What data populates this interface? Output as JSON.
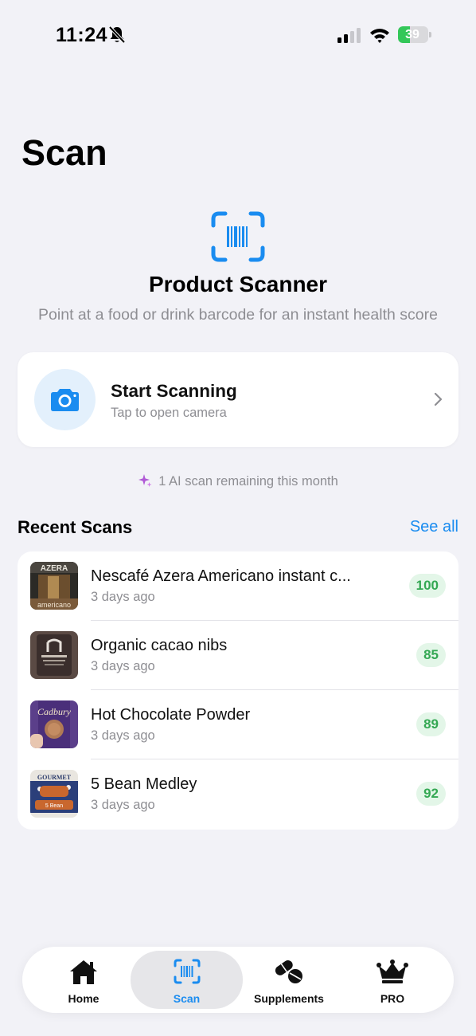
{
  "status_bar": {
    "time": "11:24",
    "battery": "39",
    "battery_level": 0.39
  },
  "page": {
    "title": "Scan"
  },
  "hero": {
    "title": "Product Scanner",
    "subtitle": "Point at a food or drink barcode for an instant health score",
    "icon": "barcode-scan-icon"
  },
  "scan_card": {
    "title": "Start Scanning",
    "subtitle": "Tap to open camera",
    "icon": "camera-icon"
  },
  "ai_note": "1 AI scan remaining this month",
  "recent": {
    "title": "Recent Scans",
    "see_all": "See all",
    "items": [
      {
        "name": "Nescafé Azera Americano instant c...",
        "time": "3 days ago",
        "score": "100"
      },
      {
        "name": "Organic cacao nibs",
        "time": "3 days ago",
        "score": "85"
      },
      {
        "name": "Hot Chocolate Powder",
        "time": "3 days ago",
        "score": "89"
      },
      {
        "name": "5 Bean Medley",
        "time": "3 days ago",
        "score": "92"
      }
    ]
  },
  "tab_bar": {
    "active": "Scan",
    "tabs": [
      {
        "label": "Home",
        "icon": "house-icon"
      },
      {
        "label": "Scan",
        "icon": "barcode-scan-icon"
      },
      {
        "label": "Supplements",
        "icon": "pills-icon"
      },
      {
        "label": "PRO",
        "icon": "crown-icon"
      }
    ]
  },
  "colors": {
    "accent": "#1a8cf0",
    "score_green": "#34a853",
    "score_bg": "#e3f6e8",
    "battery_green": "#34c759"
  }
}
